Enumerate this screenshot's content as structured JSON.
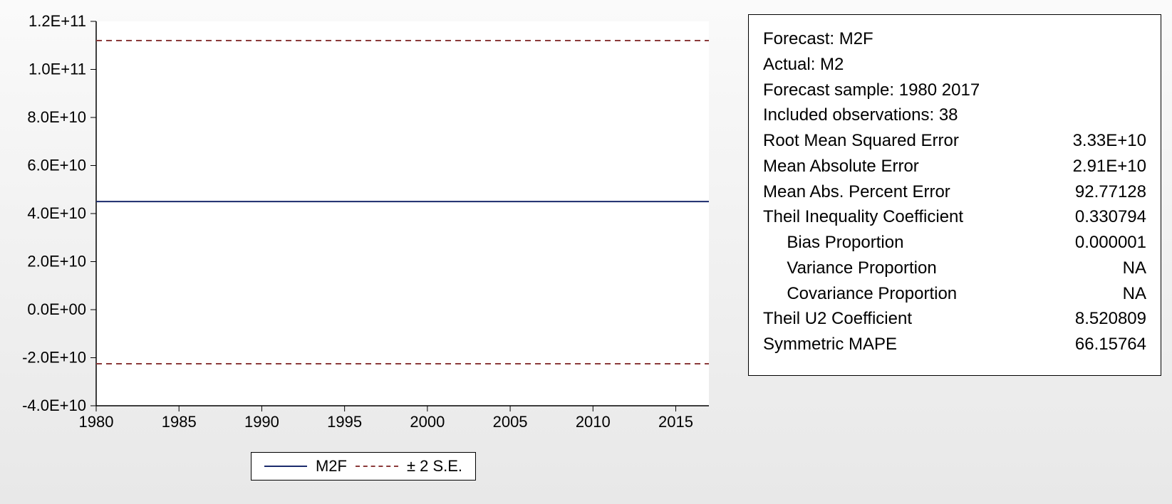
{
  "chart_data": {
    "type": "line",
    "title": "",
    "xlabel": "",
    "ylabel": "",
    "x_ticks": [
      "1980",
      "1985",
      "1990",
      "1995",
      "2000",
      "2005",
      "2010",
      "2015"
    ],
    "y_ticks": [
      "-4.0E+10",
      "-2.0E+10",
      "0.0E+00",
      "2.0E+10",
      "4.0E+10",
      "6.0E+10",
      "8.0E+10",
      "1.0E+11",
      "1.2E+11"
    ],
    "xlim": [
      1980,
      2017
    ],
    "ylim": [
      -40000000000.0,
      120000000000.0
    ],
    "series": [
      {
        "name": "M2F",
        "style": "solid",
        "x": [
          1980,
          2017
        ],
        "y": [
          45000000000.0,
          45000000000.0
        ]
      },
      {
        "name": "± 2 S.E.",
        "style": "dashed",
        "x": [
          1980,
          2017
        ],
        "y_upper": [
          112000000000.0,
          112000000000.0
        ],
        "y_lower": [
          -22500000000.0,
          -22500000000.0
        ]
      }
    ]
  },
  "legend": {
    "m2f": "M2F",
    "se": "± 2 S.E."
  },
  "stats": {
    "forecast": "Forecast: M2F",
    "actual": "Actual: M2",
    "sample": "Forecast sample: 1980 2017",
    "obs": "Included observations: 38",
    "rmse_label": "Root Mean Squared Error",
    "rmse_value": "3.33E+10",
    "mae_label": "Mean Absolute Error",
    "mae_value": "2.91E+10",
    "mape_label": "Mean Abs. Percent Error",
    "mape_value": "92.77128",
    "theil_label": "Theil Inequality Coefficient",
    "theil_value": "0.330794",
    "bias_label": "     Bias Proportion",
    "bias_value": "0.000001",
    "var_label": "     Variance Proportion",
    "var_value": "       NA",
    "cov_label": "     Covariance Proportion",
    "cov_value": "       NA",
    "u2_label": "Theil U2 Coefficient",
    "u2_value": "8.520809",
    "smape_label": "Symmetric MAPE",
    "smape_value": "66.15764"
  }
}
